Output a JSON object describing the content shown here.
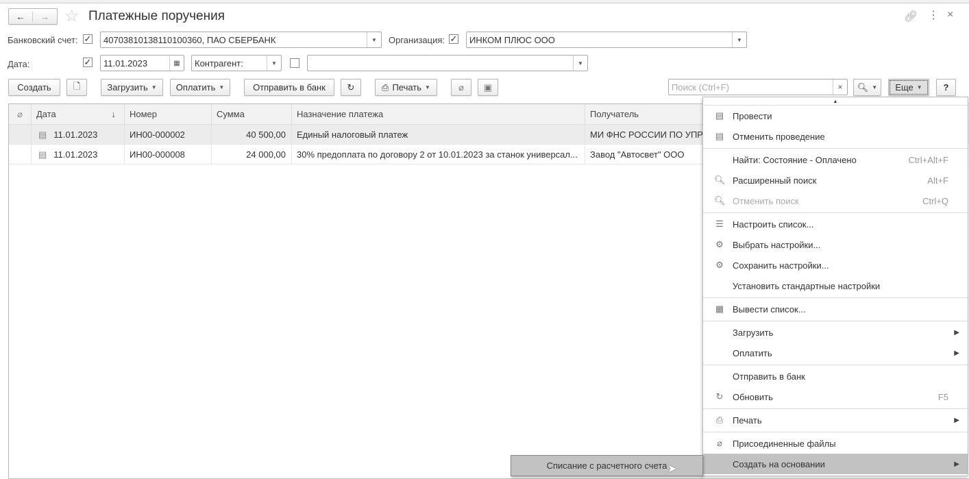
{
  "window": {
    "title": "Платежные поручения",
    "link_icon": "link-icon",
    "more_icon": "⋮",
    "close_icon": "×"
  },
  "filters": {
    "bank_account_label": "Банковский счет:",
    "bank_account_value": "40703810138110100360, ПАО СБЕРБАНК",
    "org_label": "Организация:",
    "org_value": "ИНКОМ ПЛЮС ООО",
    "date_label": "Дата:",
    "date_value": "11.01.2023",
    "counterparty_label": "Контрагент:",
    "counterparty_value": ""
  },
  "toolbar": {
    "create": "Создать",
    "load": "Загрузить",
    "pay": "Оплатить",
    "send": "Отправить в банк",
    "print": "Печать",
    "search_placeholder": "Поиск (Ctrl+F)",
    "more": "Еще",
    "help": "?"
  },
  "table": {
    "columns": [
      "Дата",
      "Номер",
      "Сумма",
      "Назначение платежа",
      "Получатель"
    ],
    "rows": [
      {
        "date": "11.01.2023",
        "number": "ИН00-000002",
        "sum": "40 500,00",
        "purpose": "Единый налоговый платеж",
        "recipient": "МИ ФНС РОССИИ ПО УПР"
      },
      {
        "date": "11.01.2023",
        "number": "ИН00-000008",
        "sum": "24 000,00",
        "purpose": "30% предоплата по договору 2 от 10.01.2023 за станок универсал...",
        "recipient": "Завод \"Автосвет\" ООО"
      }
    ]
  },
  "menu": [
    {
      "label": "Провести",
      "icon": "post-doc-icon",
      "glyph": "▤",
      "group": 0
    },
    {
      "label": "Отменить проведение",
      "icon": "unpost-doc-icon",
      "glyph": "▤",
      "group": 0
    },
    {
      "label": "Найти: Состояние - Оплачено",
      "shortcut": "Ctrl+Alt+F",
      "group": 1
    },
    {
      "label": "Расширенный поиск",
      "shortcut": "Alt+F",
      "icon": "search-icon",
      "glyph": "🔍︎",
      "group": 1
    },
    {
      "label": "Отменить поиск",
      "shortcut": "Ctrl+Q",
      "icon": "cancel-search-icon",
      "glyph": "🔍︎",
      "group": 1,
      "disabled": true
    },
    {
      "label": "Настроить список...",
      "icon": "list-settings-icon",
      "glyph": "☰",
      "group": 2
    },
    {
      "label": "Выбрать настройки...",
      "icon": "choose-settings-icon",
      "glyph": "⚙",
      "group": 2
    },
    {
      "label": "Сохранить настройки...",
      "icon": "save-settings-icon",
      "glyph": "⚙",
      "group": 2
    },
    {
      "label": "Установить стандартные настройки",
      "group": 2
    },
    {
      "label": "Вывести список...",
      "icon": "output-list-icon",
      "glyph": "▦",
      "group": 3
    },
    {
      "label": "Загрузить",
      "submenu": true,
      "group": 4
    },
    {
      "label": "Оплатить",
      "submenu": true,
      "group": 4
    },
    {
      "label": "Отправить в банк",
      "group": 5
    },
    {
      "label": "Обновить",
      "shortcut": "F5",
      "icon": "refresh-icon",
      "glyph": "↻",
      "group": 5
    },
    {
      "label": "Печать",
      "submenu": true,
      "icon": "print-icon",
      "glyph": "⎙",
      "group": 6
    },
    {
      "label": "Присоединенные файлы",
      "icon": "paperclip-icon",
      "glyph": "⌀",
      "group": 7
    },
    {
      "label": "Создать на основании",
      "submenu": true,
      "group": 7,
      "highlighted": true
    }
  ],
  "submenu": {
    "item": "Списание с расчетного счета"
  }
}
